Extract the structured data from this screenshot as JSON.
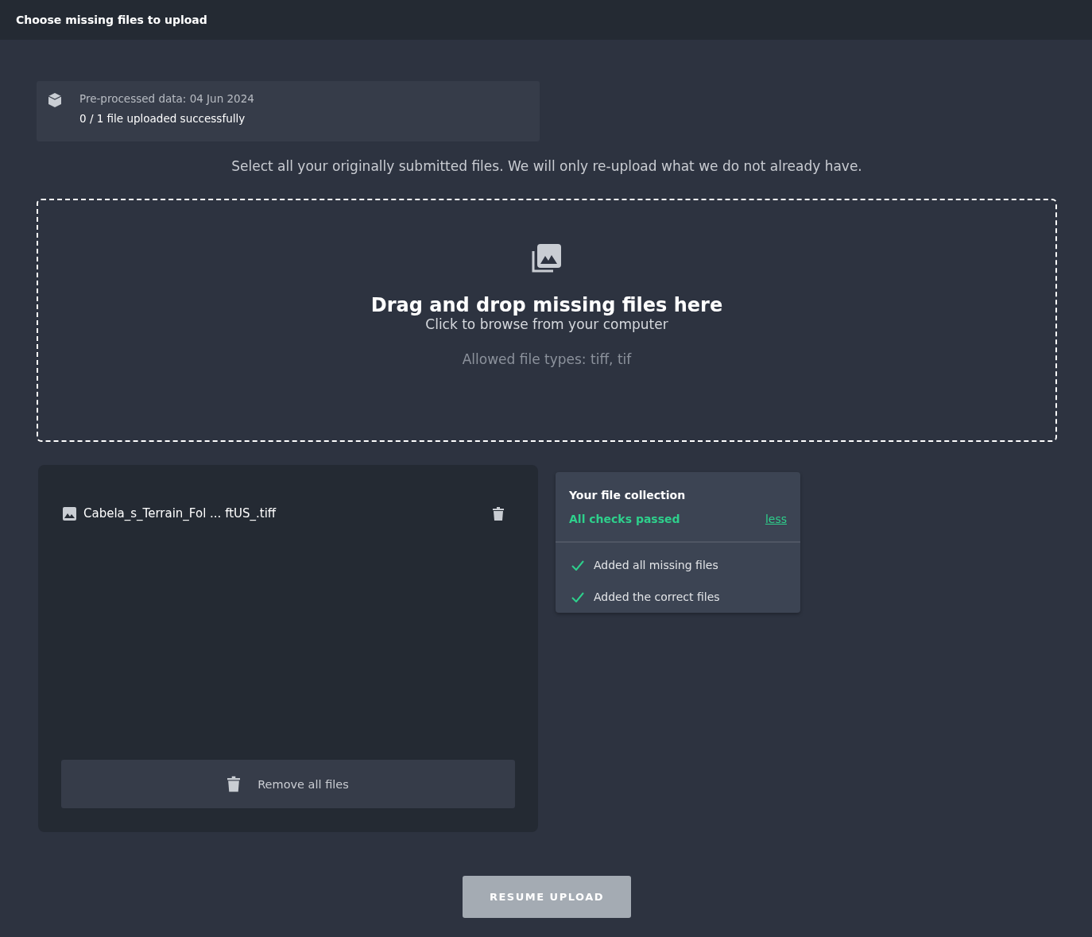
{
  "header": {
    "title": "Choose missing files to upload"
  },
  "info": {
    "title": "Pre-processed data: 04 Jun 2024",
    "status": "0 / 1 file uploaded successfully"
  },
  "instruction": "Select all your originally submitted files. We will only re-upload what we do not already have.",
  "dropzone": {
    "heading": "Drag and drop missing files here",
    "subheading": "Click to browse from your computer",
    "allowed": "Allowed file types: tiff, tif"
  },
  "files": [
    {
      "name": "Cabela_s_Terrain_Fol ... ftUS_.tiff"
    }
  ],
  "remove_all": "Remove all files",
  "collection": {
    "title": "Your file collection",
    "status": "All checks passed",
    "toggle": "less",
    "checks": [
      {
        "label": "Added all missing files",
        "passed": true
      },
      {
        "label": "Added the correct files",
        "passed": true
      }
    ]
  },
  "resume": {
    "label": "RESUME UPLOAD",
    "disabled": true
  }
}
